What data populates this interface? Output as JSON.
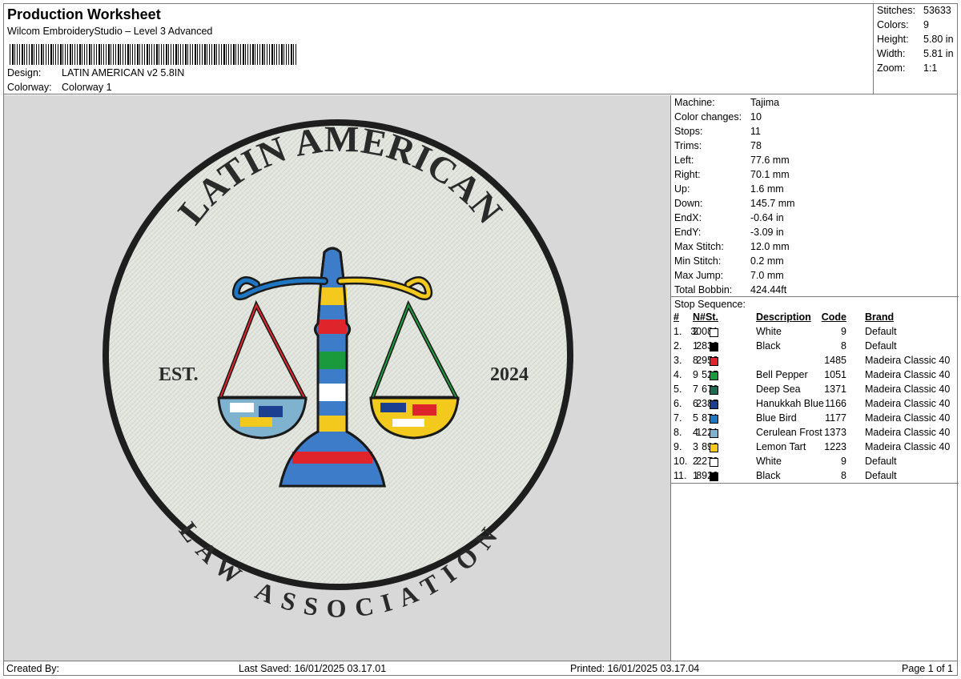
{
  "header": {
    "title": "Production Worksheet",
    "subtitle": "Wilcom EmbroideryStudio – Level 3 Advanced",
    "design_label": "Design:",
    "design_value": "LATIN AMERICAN v2 5.8IN",
    "colorway_label": "Colorway:",
    "colorway_value": "Colorway 1"
  },
  "summary": [
    {
      "label": "Stitches:",
      "value": "53633"
    },
    {
      "label": "Colors:",
      "value": "9"
    },
    {
      "label": "Height:",
      "value": "5.80 in"
    },
    {
      "label": "Width:",
      "value": "5.81 in"
    },
    {
      "label": "Zoom:",
      "value": "1:1"
    }
  ],
  "machine": [
    {
      "label": "Machine:",
      "value": "Tajima"
    },
    {
      "label": "Color changes:",
      "value": "10"
    },
    {
      "label": "Stops:",
      "value": "11"
    },
    {
      "label": "Trims:",
      "value": "78"
    },
    {
      "label": "Left:",
      "value": "77.6 mm"
    },
    {
      "label": "Right:",
      "value": "70.1 mm"
    },
    {
      "label": "Up:",
      "value": "1.6 mm"
    },
    {
      "label": "Down:",
      "value": "145.7 mm"
    },
    {
      "label": "EndX:",
      "value": "-0.64 in"
    },
    {
      "label": "EndY:",
      "value": "-3.09 in"
    },
    {
      "label": "Max Stitch:",
      "value": "12.0 mm"
    },
    {
      "label": "Min Stitch:",
      "value": "0.2 mm"
    },
    {
      "label": "Max Jump:",
      "value": "7.0 mm"
    },
    {
      "label": "Total Bobbin:",
      "value": "424.44ft"
    }
  ],
  "stop_sequence": {
    "title": "Stop Sequence:",
    "headers": {
      "num": "#",
      "n": "N#",
      "st": "St.",
      "desc": "Description",
      "code": "Code",
      "brand": "Brand"
    },
    "rows": [
      {
        "num": "1.",
        "n": "2",
        "color": "#ffffff",
        "st": "30081",
        "desc": "White",
        "code": "9",
        "brand": "Default"
      },
      {
        "num": "2.",
        "n": "1",
        "color": "#000000",
        "st": "2830",
        "desc": "Black",
        "code": "8",
        "brand": "Default"
      },
      {
        "num": "3.",
        "n": "8",
        "color": "#e0242b",
        "st": "2952",
        "desc": "",
        "code": "1485",
        "brand": "Madeira Classic 40"
      },
      {
        "num": "4.",
        "n": "9",
        "color": "#1a9a3c",
        "st": "525",
        "desc": "Bell Pepper",
        "code": "1051",
        "brand": "Madeira Classic 40"
      },
      {
        "num": "5.",
        "n": "7",
        "color": "#1f6a52",
        "st": "670",
        "desc": "Deep Sea",
        "code": "1371",
        "brand": "Madeira Classic 40"
      },
      {
        "num": "6.",
        "n": "6",
        "color": "#1c3f8f",
        "st": "2387",
        "desc": "Hanukkah Blue",
        "code": "1166",
        "brand": "Madeira Classic 40"
      },
      {
        "num": "7.",
        "n": "5",
        "color": "#1f76c2",
        "st": "871",
        "desc": "Blue Bird",
        "code": "1177",
        "brand": "Madeira Classic 40"
      },
      {
        "num": "8.",
        "n": "4",
        "color": "#7fb2cf",
        "st": "1221",
        "desc": "Cerulean Frost",
        "code": "1373",
        "brand": "Madeira Classic 40"
      },
      {
        "num": "9.",
        "n": "3",
        "color": "#f2c91c",
        "st": "893",
        "desc": "Lemon Tart",
        "code": "1223",
        "brand": "Madeira Classic 40"
      },
      {
        "num": "10.",
        "n": "2",
        "color": "#ffffff",
        "st": "2278",
        "desc": "White",
        "code": "9",
        "brand": "Default"
      },
      {
        "num": "11.",
        "n": "1",
        "color": "#000000",
        "st": "8923",
        "desc": "Black",
        "code": "8",
        "brand": "Default"
      }
    ]
  },
  "design": {
    "top_text": "LATIN AMERICAN",
    "bottom_text": "LAW ASSOCIATION",
    "left_text": "EST.",
    "right_text": "2024",
    "patch_color": "#e3e7e0",
    "border_color": "#1e1e1e"
  },
  "footer": {
    "created_by": "Created By:",
    "last_saved": "Last Saved: 16/01/2025 03.17.01",
    "printed": "Printed: 16/01/2025 03.17.04",
    "page": "Page 1 of 1"
  }
}
